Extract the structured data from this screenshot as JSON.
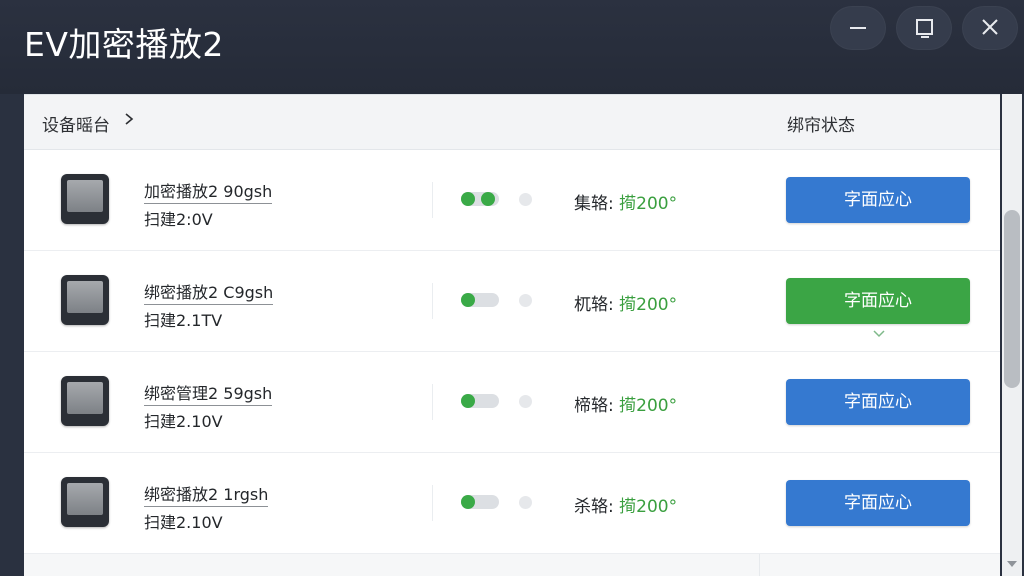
{
  "window": {
    "title": "EV加密播放2"
  },
  "header": {
    "left_label": "设备暚台",
    "right_label": "绑帘状态"
  },
  "rows": [
    {
      "name": "加密播放2 90gsh",
      "version": "扫建2:0V",
      "status_label": "集辂:",
      "status_value": "㨚200°",
      "button_label": "字面应心",
      "button_color": "#3579d0"
    },
    {
      "name": "绑密播放2 C9gsh",
      "version": "扫建2.1TV",
      "status_label": "杌辂:",
      "status_value": "㨚200°",
      "button_label": "字面应心",
      "button_color": "#3ba545"
    },
    {
      "name": "绑密管理2 59gsh",
      "version": "扫建2.10V",
      "status_label": "楴辂:",
      "status_value": "㨚200°",
      "button_label": "字面应心",
      "button_color": "#3579d0"
    },
    {
      "name": "绑密播放2 1rgsh",
      "version": "扫建2.10V",
      "status_label": "杀辂:",
      "status_value": "㨚200°",
      "button_label": "字面应心",
      "button_color": "#3579d0"
    }
  ],
  "icons": {
    "minimize": "minimize-icon",
    "maximize": "maximize-icon",
    "close": "close-icon",
    "chevron_right": "chevron-right-icon",
    "chevron_down": "chevron-down-icon",
    "device": "device-icon"
  },
  "colors": {
    "titlebar": "#2a3140",
    "accent_blue": "#3579d0",
    "accent_green": "#3ba545",
    "status_green": "#3a9f3f"
  }
}
